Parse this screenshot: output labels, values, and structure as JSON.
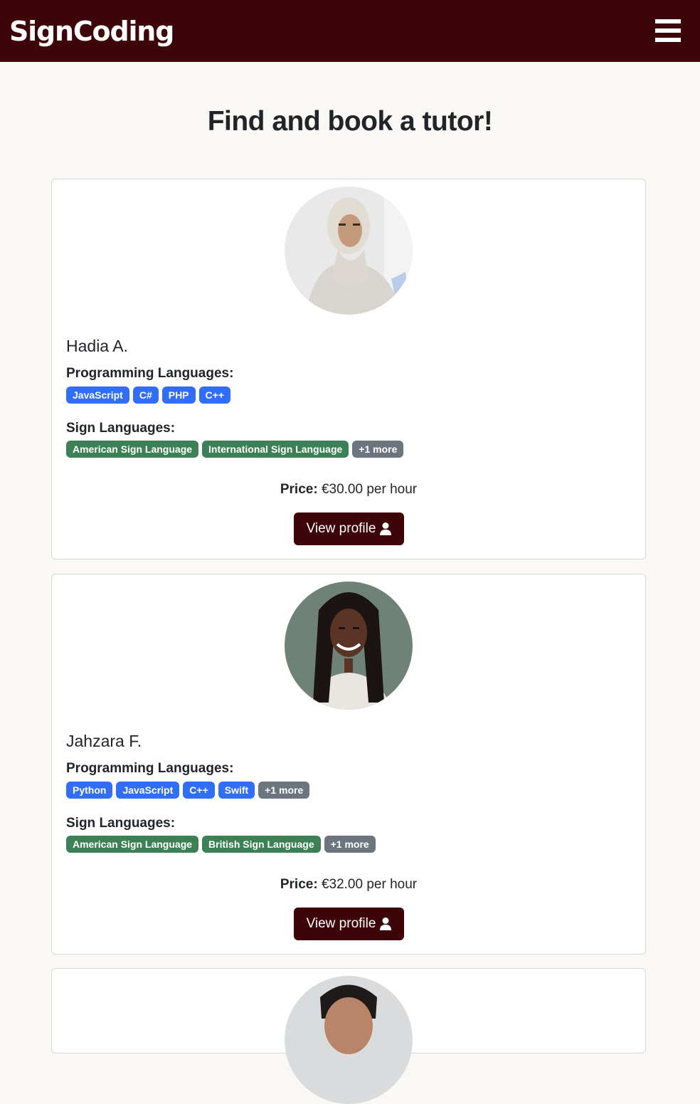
{
  "navbar": {
    "brand": "SignCoding",
    "menu_icon": "hamburger-menu-icon"
  },
  "page": {
    "title": "Find and book a tutor!"
  },
  "labels": {
    "programming": "Programming Languages:",
    "sign": "Sign Languages:",
    "price": "Price:",
    "view_profile": "View profile",
    "view_profile_icon": "user-icon"
  },
  "tutors": [
    {
      "name": "Hadia A.",
      "programming_languages": [
        "JavaScript",
        "C#",
        "PHP",
        "C++"
      ],
      "programming_more": "",
      "sign_languages": [
        "American Sign Language",
        "International Sign Language"
      ],
      "sign_more": "+1 more",
      "price": "€30.00 per hour"
    },
    {
      "name": "Jahzara F.",
      "programming_languages": [
        "Python",
        "JavaScript",
        "C++",
        "Swift"
      ],
      "programming_more": "+1 more",
      "sign_languages": [
        "American Sign Language",
        "British Sign Language"
      ],
      "sign_more": "+1 more",
      "price": "€32.00 per hour"
    }
  ],
  "colors": {
    "brand": "#3d0509",
    "programming_badge": "#2f6ef5",
    "sign_badge": "#3c8055",
    "more_badge": "#6c757d",
    "page_background": "#f9f8f5"
  }
}
